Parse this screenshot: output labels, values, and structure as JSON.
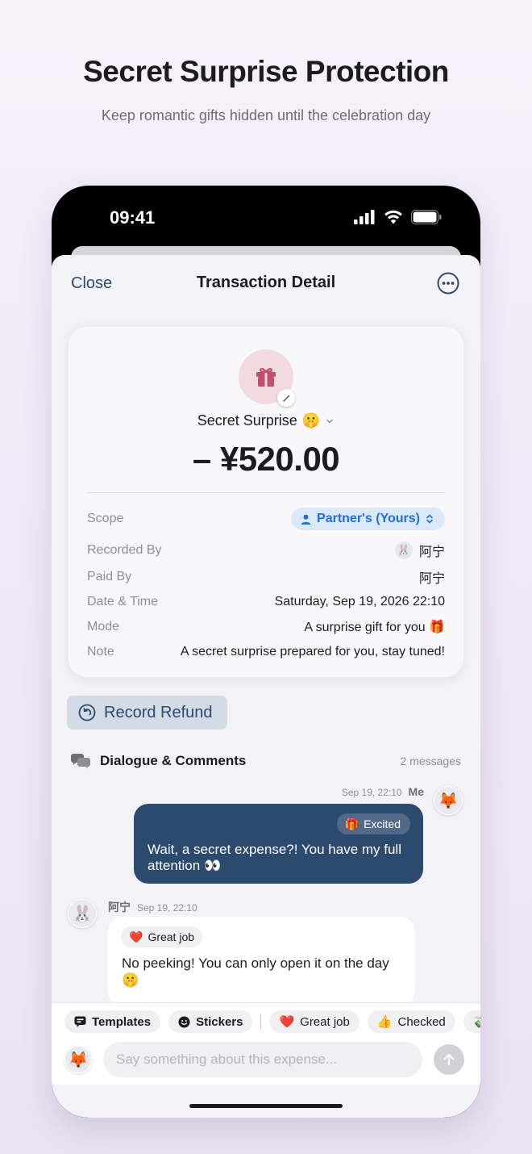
{
  "hero": {
    "title": "Secret Surprise Protection",
    "subtitle": "Keep romantic gifts hidden until the celebration day"
  },
  "status_bar": {
    "time": "09:41",
    "icons": [
      "signal-icon",
      "wifi-icon",
      "battery-icon"
    ]
  },
  "nav": {
    "close_label": "Close",
    "title": "Transaction Detail",
    "more_icon": "more-icon"
  },
  "transaction": {
    "category_icon": "gift-icon",
    "category_name": "Secret Surprise",
    "category_emoji": "🤫",
    "amount": "– ¥520.00",
    "details": {
      "scope_label": "Scope",
      "scope_value": "Partner's (Yours)",
      "recorded_by_label": "Recorded By",
      "recorded_by_avatar": "🐰",
      "recorded_by_value": "阿宁",
      "paid_by_label": "Paid By",
      "paid_by_value": "阿宁",
      "datetime_label": "Date & Time",
      "datetime_value": "Saturday, Sep 19, 2026 22:10",
      "mode_label": "Mode",
      "mode_value": "A surprise gift for you 🎁",
      "note_label": "Note",
      "note_value": "A secret surprise prepared for you, stay tuned!"
    }
  },
  "refund": {
    "label": "Record Refund"
  },
  "dialogue": {
    "title": "Dialogue & Comments",
    "count": "2 messages",
    "messages": [
      {
        "author": "Me",
        "time": "Sep 19, 22:10",
        "avatar": "🦊",
        "reaction_emoji": "🎁",
        "reaction_label": "Excited",
        "text": "Wait, a secret expense?! You have my full attention 👀"
      },
      {
        "author": "阿宁",
        "time": "Sep 19, 22:10",
        "avatar": "🐰",
        "reaction_emoji": "❤️",
        "reaction_label": "Great job",
        "text": "No peeking! You can only open it on the day 🤫"
      }
    ]
  },
  "composer": {
    "chips": {
      "templates": "Templates",
      "stickers": "Stickers",
      "great_job_emoji": "❤️",
      "great_job": "Great job",
      "checked_emoji": "👍",
      "checked": "Checked",
      "more_emoji": "💸"
    },
    "avatar": "🦊",
    "placeholder": "Say something about this expense..."
  },
  "colors": {
    "accent_navy": "#2c4a6e",
    "scope_blue": "#1f6fe0",
    "gift_pink": "#c0506e"
  }
}
